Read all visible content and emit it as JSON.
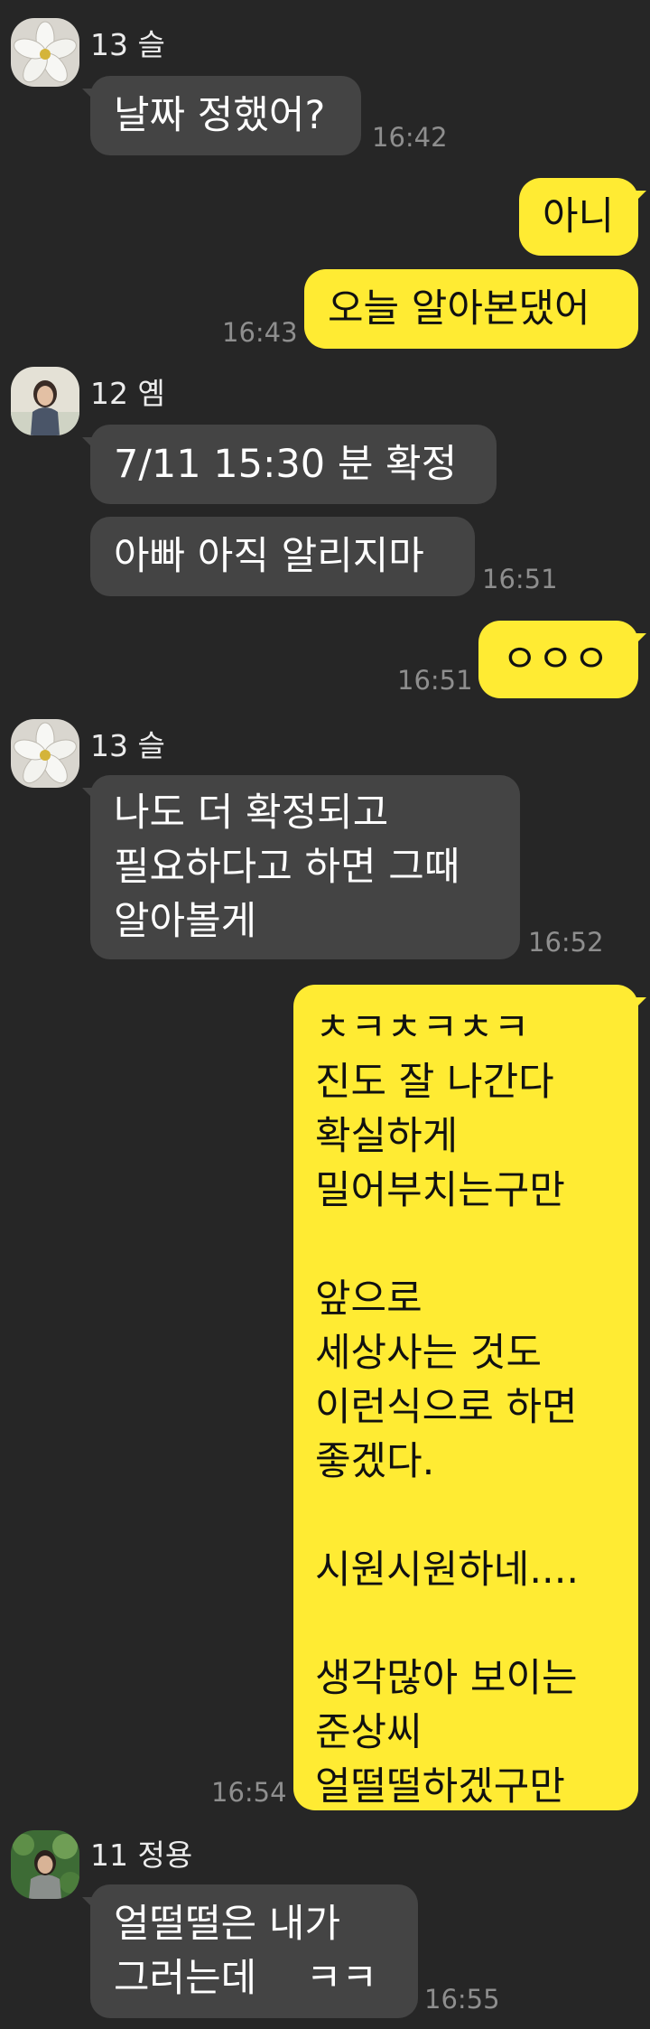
{
  "colors": {
    "background": "#262626",
    "incoming_bubble": "#444444",
    "outgoing_bubble": "#ffeb33",
    "timestamp": "#8e8e8e"
  },
  "senders": {
    "s1": "13 슬",
    "s2": "12 옘",
    "s3": "13 슬",
    "s4": "11 정용"
  },
  "messages": {
    "m1": {
      "text": "날짜 정했어?",
      "time": "16:42"
    },
    "m2": {
      "text": "아니"
    },
    "m3": {
      "text": "오늘 알아본댔어",
      "time": "16:43"
    },
    "m4": {
      "text": "7/11 15:30 분 확정"
    },
    "m5": {
      "text": "아빠 아직 알리지마",
      "time": "16:51"
    },
    "m6": {
      "text": "ㅇㅇㅇ",
      "time": "16:51"
    },
    "m7": {
      "text": "나도 더 확정되고\n필요하다고 하면 그때\n알아볼게",
      "time": "16:52"
    },
    "m8": {
      "text": "ㅊㅋㅊㅋㅊㅋ\n진도 잘 나간다\n확실하게\n밀어부치는구만\n\n앞으로\n세상사는 것도\n이런식으로 하면\n좋겠다.\n\n시원시원하네....\n\n생각많아 보이는\n준상씨\n얼떨떨하겠구만",
      "time": "16:54"
    },
    "m9": {
      "text": "얼떨떨은 내가\n그러는데    ㅋㅋ",
      "time": "16:55"
    }
  },
  "avatars": {
    "a1": "flower-avatar-icon",
    "a2": "person-avatar-icon",
    "a3": "flower-avatar-icon",
    "a4": "person-garden-avatar-icon"
  }
}
